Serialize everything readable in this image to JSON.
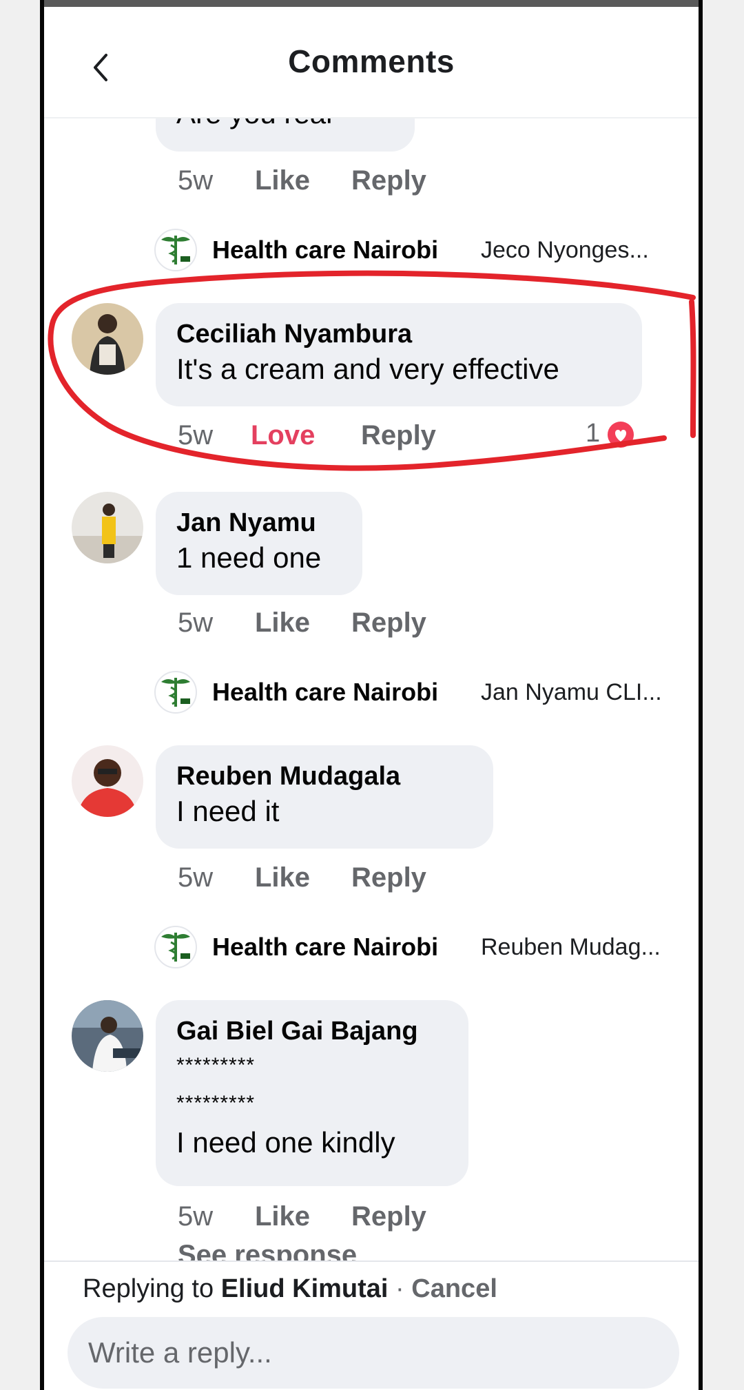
{
  "header": {
    "title": "Comments"
  },
  "comments": [
    {
      "author": "",
      "lines": [
        "Are you real"
      ],
      "time": "5w",
      "action": "Like",
      "reply": "Reply",
      "page_reply": {
        "page": "Health care Nairobi",
        "preview": "Jeco Nyonges..."
      }
    },
    {
      "author": "Ceciliah Nyambura",
      "lines": [
        "It's a cream and very effective"
      ],
      "time": "5w",
      "action": "Love",
      "reply": "Reply",
      "reaction_count": "1",
      "highlighted": true
    },
    {
      "author": "Jan Nyamu",
      "lines": [
        "1 need one"
      ],
      "time": "5w",
      "action": "Like",
      "reply": "Reply",
      "page_reply": {
        "page": "Health care Nairobi",
        "preview": "Jan Nyamu CLI..."
      }
    },
    {
      "author": "Reuben Mudagala",
      "lines": [
        "I need it"
      ],
      "time": "5w",
      "action": "Like",
      "reply": "Reply",
      "page_reply": {
        "page": "Health care Nairobi",
        "preview": "Reuben Mudag..."
      }
    },
    {
      "author": "Gai Biel Gai Bajang",
      "lines": [
        "*********",
        "*********",
        "I need one kindly"
      ],
      "time": "5w",
      "action": "Like",
      "reply": "Reply",
      "see_responses": "See response"
    }
  ],
  "composer": {
    "replying_prefix": "Replying to",
    "replying_to": "Eliud Kimutai",
    "separator": "·",
    "cancel": "Cancel",
    "placeholder": "Write a reply..."
  },
  "colors": {
    "accent_love": "#e4405f",
    "highlight": "#e3242b",
    "bubble": "#eef0f4"
  },
  "icons": [
    "back-chevron-icon",
    "health-care-logo-icon",
    "love-reaction-icon"
  ]
}
